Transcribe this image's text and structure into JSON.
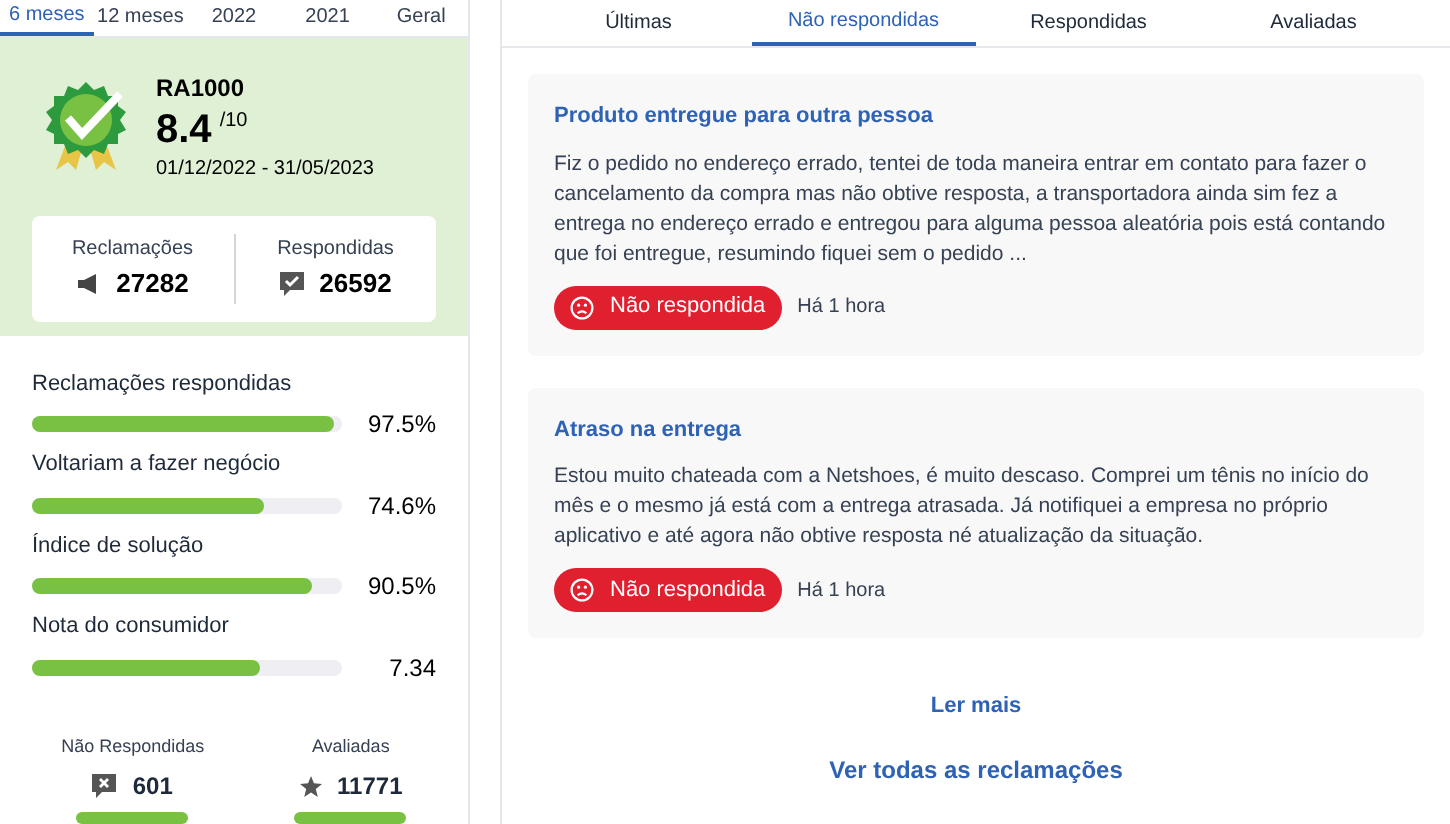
{
  "period_tabs": [
    {
      "label": "6 meses",
      "selected": true
    },
    {
      "label": "12 meses",
      "selected": false
    },
    {
      "label": "2022",
      "selected": false
    },
    {
      "label": "2021",
      "selected": false
    },
    {
      "label": "Geral",
      "selected": false
    }
  ],
  "score": {
    "badge": "RA1000",
    "value": "8.4",
    "scale": "/10",
    "period": "01/12/2022 - 31/05/2023"
  },
  "counts": [
    {
      "label": "Reclamações",
      "value": "27282",
      "kind": "megaphone"
    },
    {
      "label": "Respondidas",
      "value": "26592",
      "kind": "answered"
    }
  ],
  "metrics": [
    {
      "label": "Reclamações respondidas",
      "level": 0.975,
      "reading": "97.5%"
    },
    {
      "label": "Voltariam a fazer negócio",
      "level": 0.746,
      "reading": "74.6%"
    },
    {
      "label": "Índice de solução",
      "level": 0.905,
      "reading": "90.5%"
    },
    {
      "label": "Nota do consumidor",
      "level": 0.734,
      "reading": "7.34"
    }
  ],
  "bottom_stats": [
    {
      "label": "Não Respondidas",
      "value": "601",
      "kind": "unanswered"
    },
    {
      "label": "Avaliadas",
      "value": "11771",
      "kind": "star"
    }
  ],
  "complaint_tabs": [
    {
      "label": "Últimas",
      "selected": false
    },
    {
      "label": "Não respondidas",
      "selected": true
    },
    {
      "label": "Respondidas",
      "selected": false
    },
    {
      "label": "Avaliadas",
      "selected": false
    }
  ],
  "complaints": [
    {
      "title": "Produto entregue para outra pessoa",
      "text": "Fiz o pedido no endereço errado, tentei de toda maneira entrar em contato para fazer o cancelamento da compra mas não obtive resposta, a transportadora ainda sim fez a entrega no endereço errado e entregou para alguma pessoa aleatória pois está contando que foi entregue, resumindo fiquei sem o pedido ...",
      "status": "Não respondida",
      "time": "Há 1 hora"
    },
    {
      "title": "Atraso na entrega",
      "text": "Estou muito chateada com a Netshoes, é muito descaso. Comprei um tênis no início do mês e o mesmo já está com a entrega atrasada. Já notifiquei a empresa no próprio aplicativo e até agora não obtive resposta né atualização da situação.",
      "status": "Não respondida",
      "time": "Há 1 hora"
    }
  ],
  "read_more": "Ler mais",
  "see_all": "Ver todas as reclamações"
}
